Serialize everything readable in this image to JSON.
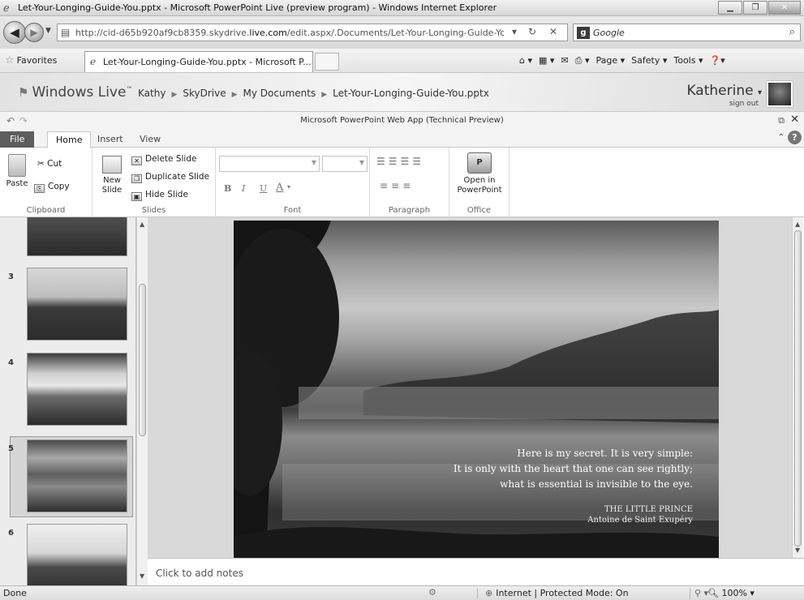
{
  "window": {
    "title": "Let-Your-Longing-Guide-You.pptx - Microsoft PowerPoint Live (preview program) - Windows Internet Explorer"
  },
  "browser": {
    "url_prefix": "http://cid-d65b920af9cb8359.skydrive.",
    "url_domain": "live.com",
    "url_suffix": "/edit.aspx/.Documents/Let-Your-Longing-Guide-You.pp",
    "search_placeholder": "Google",
    "favorites_label": "Favorites",
    "tab_title": "Let-Your-Longing-Guide-You.pptx - Microsoft P...",
    "commands": [
      "Page ▾",
      "Safety ▾",
      "Tools ▾"
    ]
  },
  "live_header": {
    "logo": "Windows Live",
    "logo_tm": "™",
    "breadcrumb": [
      "Kathy",
      "SkyDrive",
      "My Documents",
      "Let-Your-Longing-Guide-You.pptx"
    ],
    "user_name": "Katherine",
    "sign_out": "sign out"
  },
  "app": {
    "title": "Microsoft PowerPoint Web App (Technical Preview)"
  },
  "ribbon": {
    "tabs": [
      "File",
      "Home",
      "Insert",
      "View"
    ],
    "active_tab": "Home",
    "clipboard": {
      "paste": "Paste",
      "cut": "Cut",
      "copy": "Copy",
      "label": "Clipboard"
    },
    "slides": {
      "new_slide_1": "New",
      "new_slide_2": "Slide",
      "delete": "Delete Slide",
      "duplicate": "Duplicate Slide",
      "hide": "Hide Slide",
      "label": "Slides"
    },
    "font": {
      "bold": "B",
      "italic": "I",
      "underline": "U",
      "color": "A",
      "label": "Font"
    },
    "paragraph": {
      "label": "Paragraph"
    },
    "office": {
      "open_1": "Open in",
      "open_2": "PowerPoint",
      "label": "Office"
    }
  },
  "slides_pane": {
    "numbers": [
      "3",
      "4",
      "5",
      "6"
    ],
    "selected": "5"
  },
  "slide": {
    "quote_lines": [
      "Here is my secret. It is very simple:",
      "It is only with the heart that one can see rightly;",
      "what is essential  is invisible  to the eye."
    ],
    "book": "THE LITTLE PRINCE",
    "author": "Antoine de Saint Exupéry"
  },
  "notes": {
    "placeholder": "Click to add notes"
  },
  "status": {
    "left": "Done",
    "zone": "Internet | Protected Mode: On",
    "zoom": "100%"
  }
}
